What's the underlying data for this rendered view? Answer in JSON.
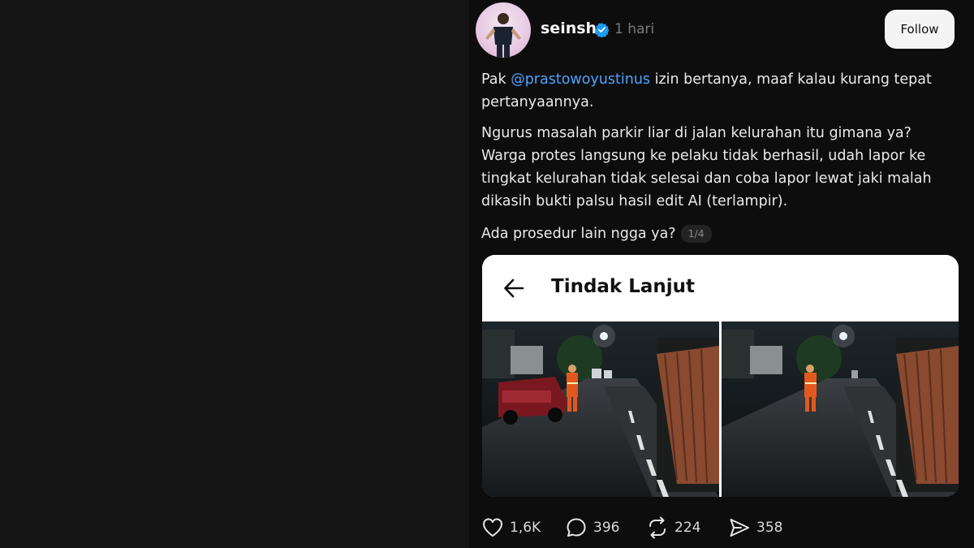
{
  "post": {
    "username": "seinsh",
    "timestamp": "1 hari",
    "follow_label": "Follow",
    "paragraph1_before": "Pak ",
    "mention": "@prastowoyustinus",
    "paragraph1_after": " izin bertanya, maaf kalau kurang tepat pertanyaannya.",
    "paragraph2": "Ngurus masalah parkir liar di jalan kelurahan itu gimana ya? Warga protes langsung ke pelaku tidak berhasil, udah lapor ke tingkat kelurahan tidak selesai dan coba lapor lewat jaki malah dikasih bukti palsu hasil edit AI (terlampir).",
    "paragraph3": "Ada prosedur lain ngga ya?",
    "media_counter": "1/4"
  },
  "media": {
    "title": "Tindak Lanjut"
  },
  "actions": {
    "likes": "1,6K",
    "replies": "396",
    "reposts": "224",
    "shares": "358"
  },
  "colors": {
    "mention": "#4ea3ff",
    "verified_badge": "#1d9bf0",
    "background": "#0d0d0d"
  },
  "icons": [
    "verified-badge-icon",
    "back-arrow-icon",
    "heart-icon",
    "reply-icon",
    "repost-icon",
    "share-icon"
  ]
}
